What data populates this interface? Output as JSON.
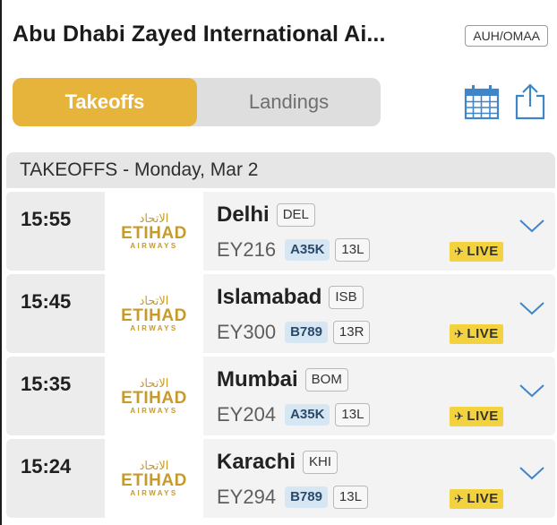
{
  "header": {
    "airport_name": "Abu Dhabi Zayed International Ai...",
    "airport_code": "AUH/OMAA"
  },
  "tabs": {
    "takeoffs": "Takeoffs",
    "landings": "Landings",
    "active": "takeoffs"
  },
  "icons": {
    "calendar": "calendar-icon",
    "share": "share-icon"
  },
  "section": {
    "title": "TAKEOFFS - Monday, Mar 2"
  },
  "airline": {
    "arabic": "الاتحاد",
    "brand": "ETIHAD",
    "sub": "AIRWAYS"
  },
  "flights": [
    {
      "time": "15:55",
      "city": "Delhi",
      "iata": "DEL",
      "flight": "EY216",
      "aircraft": "A35K",
      "gate": "13L",
      "status": "LIVE"
    },
    {
      "time": "15:45",
      "city": "Islamabad",
      "iata": "ISB",
      "flight": "EY300",
      "aircraft": "B789",
      "gate": "13R",
      "status": "LIVE"
    },
    {
      "time": "15:35",
      "city": "Mumbai",
      "iata": "BOM",
      "flight": "EY204",
      "aircraft": "A35K",
      "gate": "13L",
      "status": "LIVE"
    },
    {
      "time": "15:24",
      "city": "Karachi",
      "iata": "KHI",
      "flight": "EY294",
      "aircraft": "B789",
      "gate": "13L",
      "status": "LIVE"
    }
  ],
  "colors": {
    "accent": "#e6b43a",
    "icon_blue": "#3f86c8",
    "live_yellow": "#f3d23f",
    "logo_gold": "#c79a2c",
    "aircraft_bg": "#d7e6f3"
  }
}
